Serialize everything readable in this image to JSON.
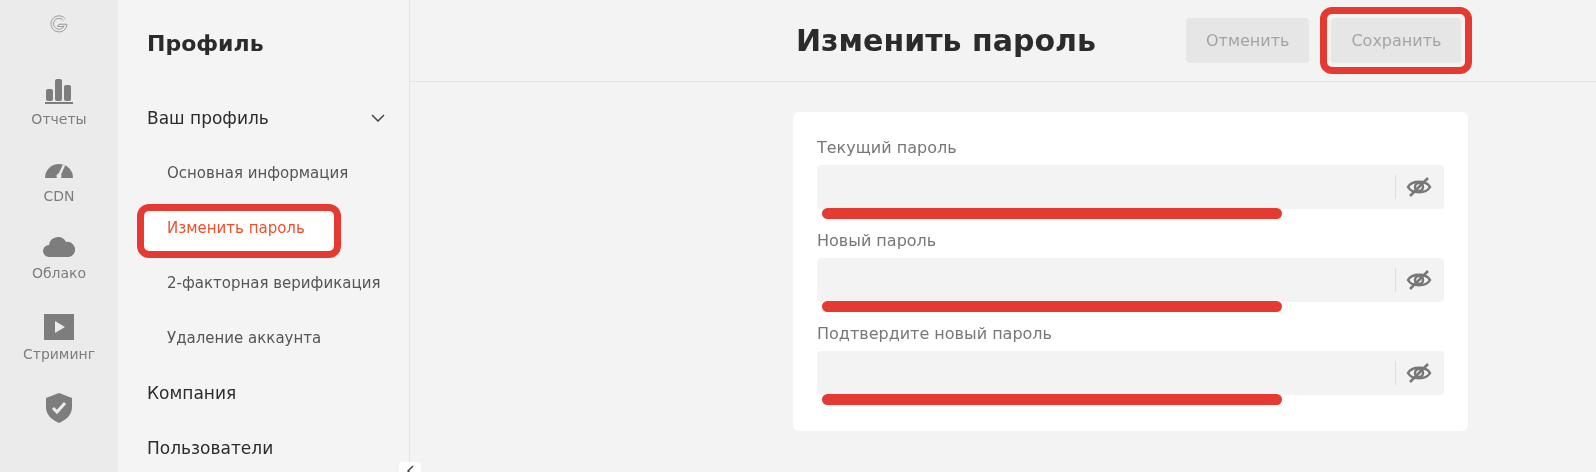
{
  "rail": [
    {
      "kind": "reports",
      "label": "Отчеты"
    },
    {
      "kind": "cdn",
      "label": "CDN"
    },
    {
      "kind": "cloud",
      "label": "Облако"
    },
    {
      "kind": "streaming",
      "label": "Стриминг"
    },
    {
      "kind": "shield"
    }
  ],
  "sidebar": {
    "title": "Профиль",
    "sections": [
      {
        "label": "Ваш профиль",
        "expanded": true,
        "children": [
          {
            "label": "Основная информация",
            "selected": false,
            "highlighted": false
          },
          {
            "label": "Изменить пароль",
            "selected": true,
            "highlighted": true
          },
          {
            "label": "2-факторная верификация",
            "selected": false,
            "highlighted": false
          },
          {
            "label": "Удаление аккаунта",
            "selected": false,
            "highlighted": false
          }
        ]
      },
      {
        "label": "Компания"
      },
      {
        "label": "Пользователи"
      }
    ]
  },
  "header": {
    "title": "Изменить пароль",
    "buttons": [
      {
        "label": "Отменить",
        "highlighted": false
      },
      {
        "label": "Сохранить",
        "highlighted": true
      }
    ]
  },
  "form": {
    "fields": [
      {
        "label": "Текущий пароль",
        "underlined": true
      },
      {
        "label": "Новый пароль",
        "underlined": true
      },
      {
        "label": "Подтвердите новый пароль",
        "underlined": true
      }
    ]
  }
}
